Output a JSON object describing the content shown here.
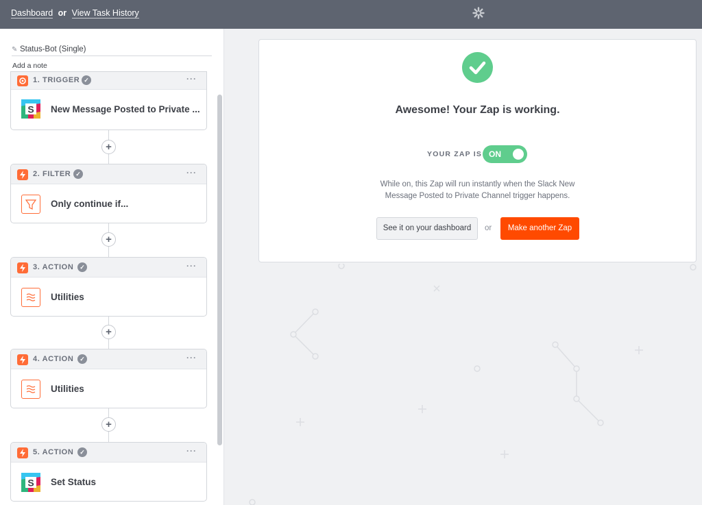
{
  "topbar": {
    "dashboard_link": "Dashboard",
    "or": "or",
    "history_link": "View Task History",
    "logo_icon": "zapier-asterisk-icon"
  },
  "sidebar": {
    "zap_name": "Status-Bot (Single)",
    "add_note": "Add a note",
    "steps": [
      {
        "label": "1. TRIGGER",
        "title": "New Message Posted to Private ...",
        "app_icon": "slack-icon",
        "badge_icon": "trigger-icon"
      },
      {
        "label": "2. FILTER",
        "title": "Only continue if...",
        "app_icon": "filter-icon",
        "badge_icon": "bolt-icon"
      },
      {
        "label": "3. ACTION",
        "title": "Utilities",
        "app_icon": "utilities-icon",
        "badge_icon": "bolt-icon"
      },
      {
        "label": "4. ACTION",
        "title": "Utilities",
        "app_icon": "utilities-icon",
        "badge_icon": "bolt-icon"
      },
      {
        "label": "5. ACTION",
        "title": "Set Status",
        "app_icon": "slack-icon",
        "badge_icon": "bolt-icon"
      }
    ],
    "add_step_symbol": "+"
  },
  "main": {
    "headline": "Awesome! Your Zap is working.",
    "zap_is_label": "YOUR ZAP IS",
    "toggle_label": "ON",
    "description": "While on, this Zap will run instantly when the Slack New Message Posted to Private Channel trigger happens.",
    "dashboard_button": "See it on your dashboard",
    "or": "or",
    "make_button": "Make another Zap"
  },
  "colors": {
    "accent_orange": "#ff4a00",
    "success_green": "#5fcd8d",
    "topbar": "#5e6470"
  }
}
